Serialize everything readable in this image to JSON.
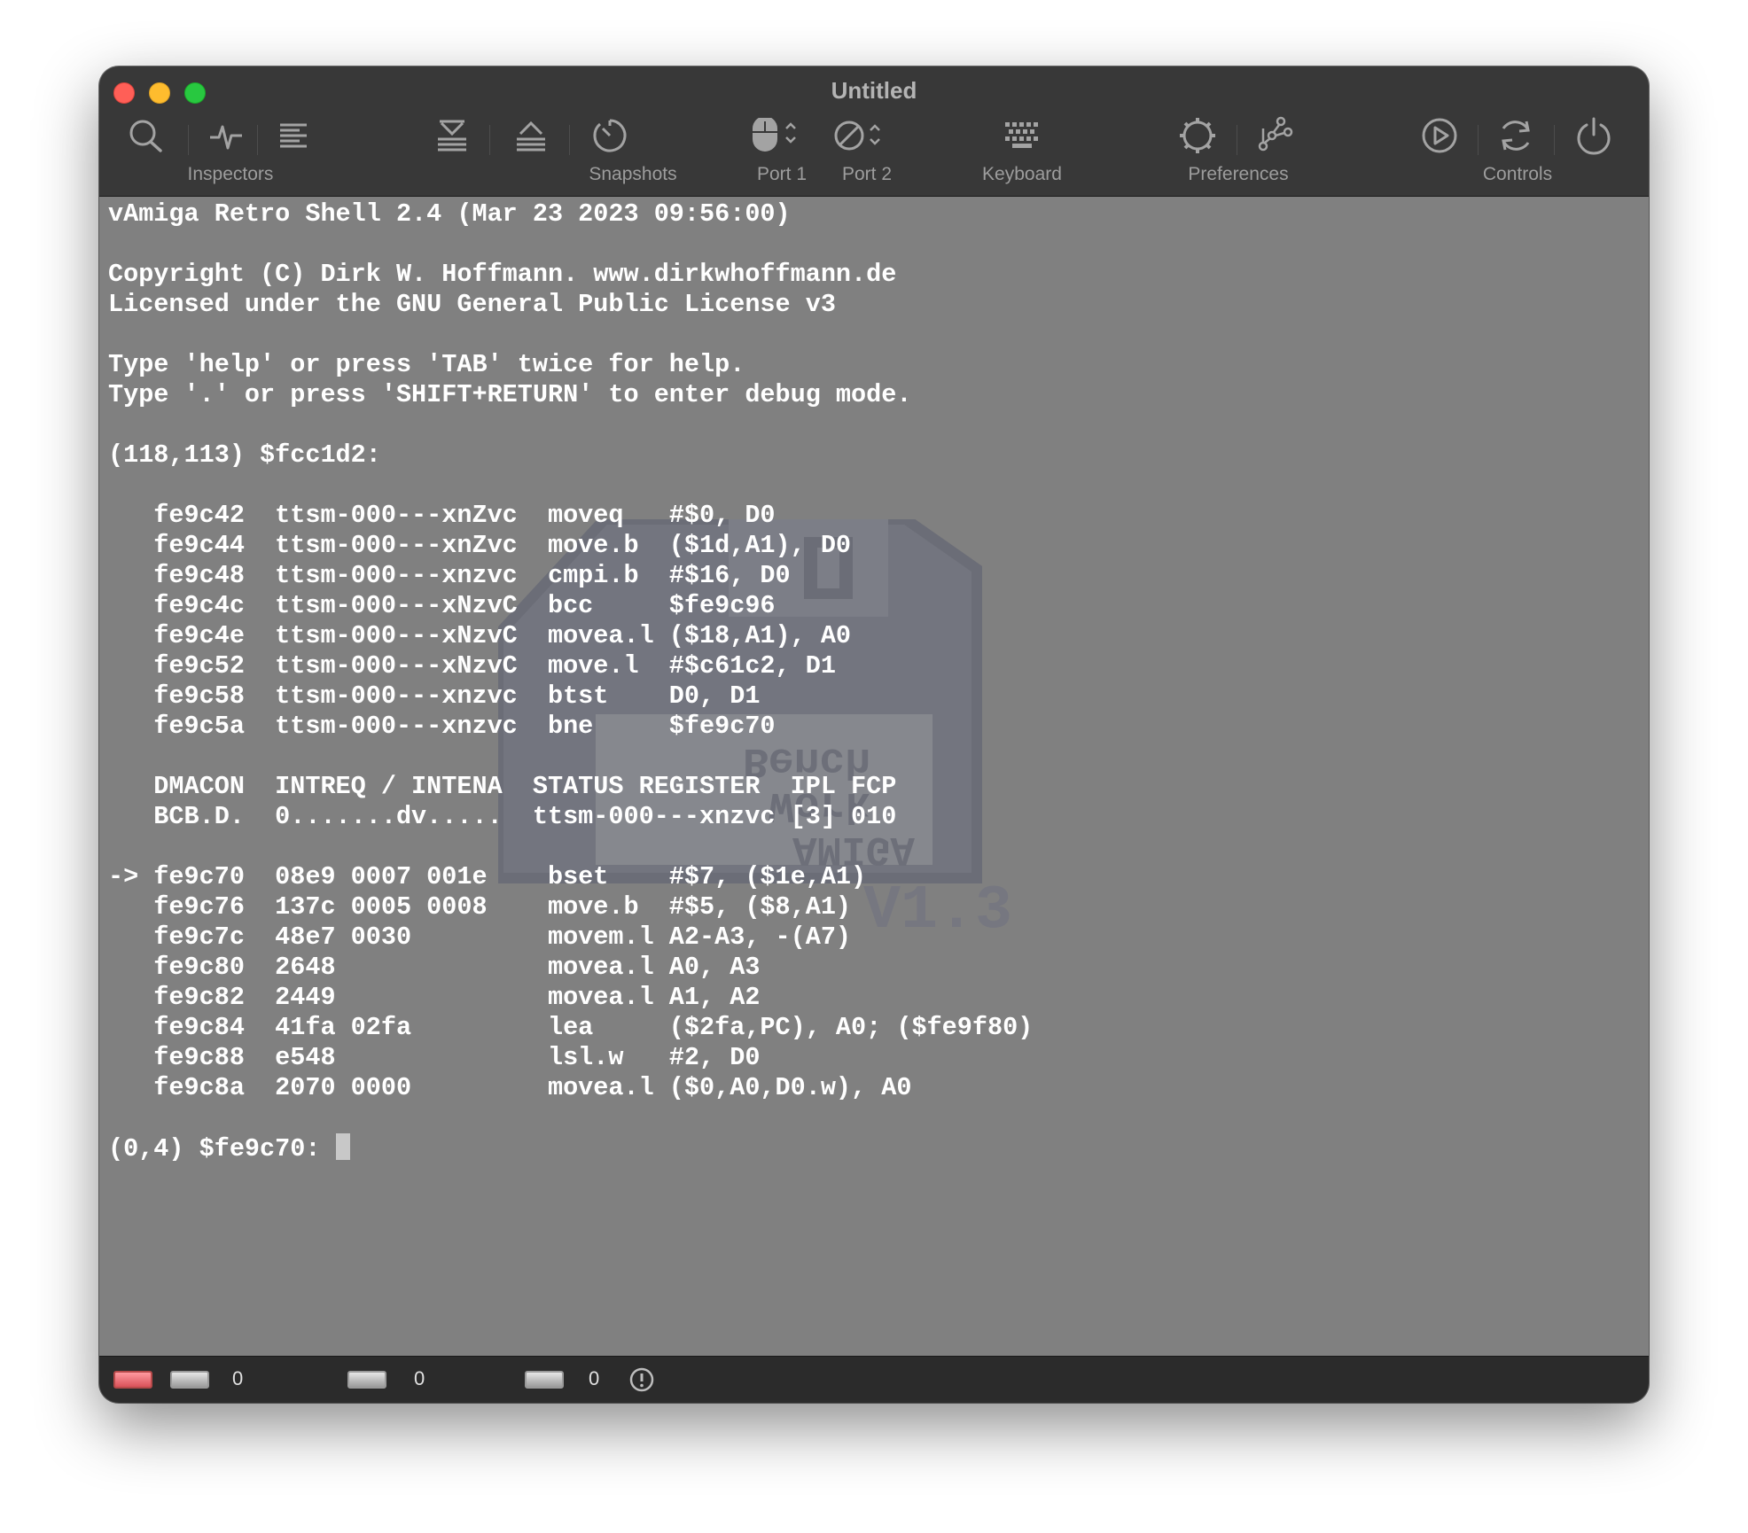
{
  "window": {
    "title": "Untitled"
  },
  "toolbar": {
    "groups": [
      {
        "label": "Inspectors",
        "icons": [
          "search-icon",
          "activity-icon",
          "list-icon"
        ]
      },
      {
        "label": "Snapshots",
        "icons": [
          "snapshot-save-icon",
          "snapshot-load-icon",
          "snapshot-browse-icon"
        ]
      },
      {
        "label": "Port 1",
        "icons": [
          "mouse-icon",
          "chevron-updown-icon"
        ]
      },
      {
        "label": "Port 2",
        "icons": [
          "none-icon",
          "chevron-updown-icon"
        ]
      },
      {
        "label": "Keyboard",
        "icons": [
          "keyboard-icon"
        ]
      },
      {
        "label": "Preferences",
        "icons": [
          "gear-icon",
          "tools-icon"
        ]
      },
      {
        "label": "Controls",
        "icons": [
          "play-icon",
          "reset-icon",
          "power-icon"
        ]
      }
    ]
  },
  "console": {
    "lines": [
      "vAmiga Retro Shell 2.4 (Mar 23 2023 09:56:00)",
      "",
      "Copyright (C) Dirk W. Hoffmann. www.dirkwhoffmann.de",
      "Licensed under the GNU General Public License v3",
      "",
      "Type 'help' or press 'TAB' twice for help.",
      "Type '.' or press 'SHIFT+RETURN' to enter debug mode.",
      "",
      "(118,113) $fcc1d2:",
      "",
      "   fe9c42  ttsm-000---xnZvc  moveq   #$0, D0",
      "   fe9c44  ttsm-000---xnZvc  move.b  ($1d,A1), D0",
      "   fe9c48  ttsm-000---xnzvc  cmpi.b  #$16, D0",
      "   fe9c4c  ttsm-000---xNzvC  bcc     $fe9c96",
      "   fe9c4e  ttsm-000---xNzvC  movea.l ($18,A1), A0",
      "   fe9c52  ttsm-000---xNzvC  move.l  #$c61c2, D1",
      "   fe9c58  ttsm-000---xnzvc  btst    D0, D1",
      "   fe9c5a  ttsm-000---xnzvc  bne     $fe9c70",
      "",
      "   DMACON  INTREQ / INTENA  STATUS REGISTER  IPL FCP",
      "   BCB.D.  0.......dv.....  ttsm-000---xnzvc [3] 010",
      "",
      "-> fe9c70  08e9 0007 001e    bset    #$7, ($1e,A1)",
      "   fe9c76  137c 0005 0008    move.b  #$5, ($8,A1)",
      "   fe9c7c  48e7 0030         movem.l A2-A3, -(A7)",
      "   fe9c80  2648              movea.l A0, A3",
      "   fe9c82  2449              movea.l A1, A2",
      "   fe9c84  41fa 02fa         lea     ($2fa,PC), A0; ($fe9f80)",
      "   fe9c88  e548              lsl.w   #2, D0",
      "   fe9c8a  2070 0000         movea.l ($0,A0,D0.w), A0",
      ""
    ],
    "prompt": "(0,4) $fe9c70: "
  },
  "watermark": {
    "line1": "Bench",
    "line2": "Work",
    "line3": "AMIGA",
    "version": "V1.3"
  },
  "statusbar": {
    "df0_count": "0",
    "df1_count": "0",
    "df2_count": "0",
    "icons": [
      "drive-icon",
      "warning-icon"
    ]
  },
  "colors": {
    "console_bg": "#808080",
    "titlebar_bg": "#383838",
    "statusbar_bg": "#2b2b2b",
    "text": "#ffffff"
  }
}
